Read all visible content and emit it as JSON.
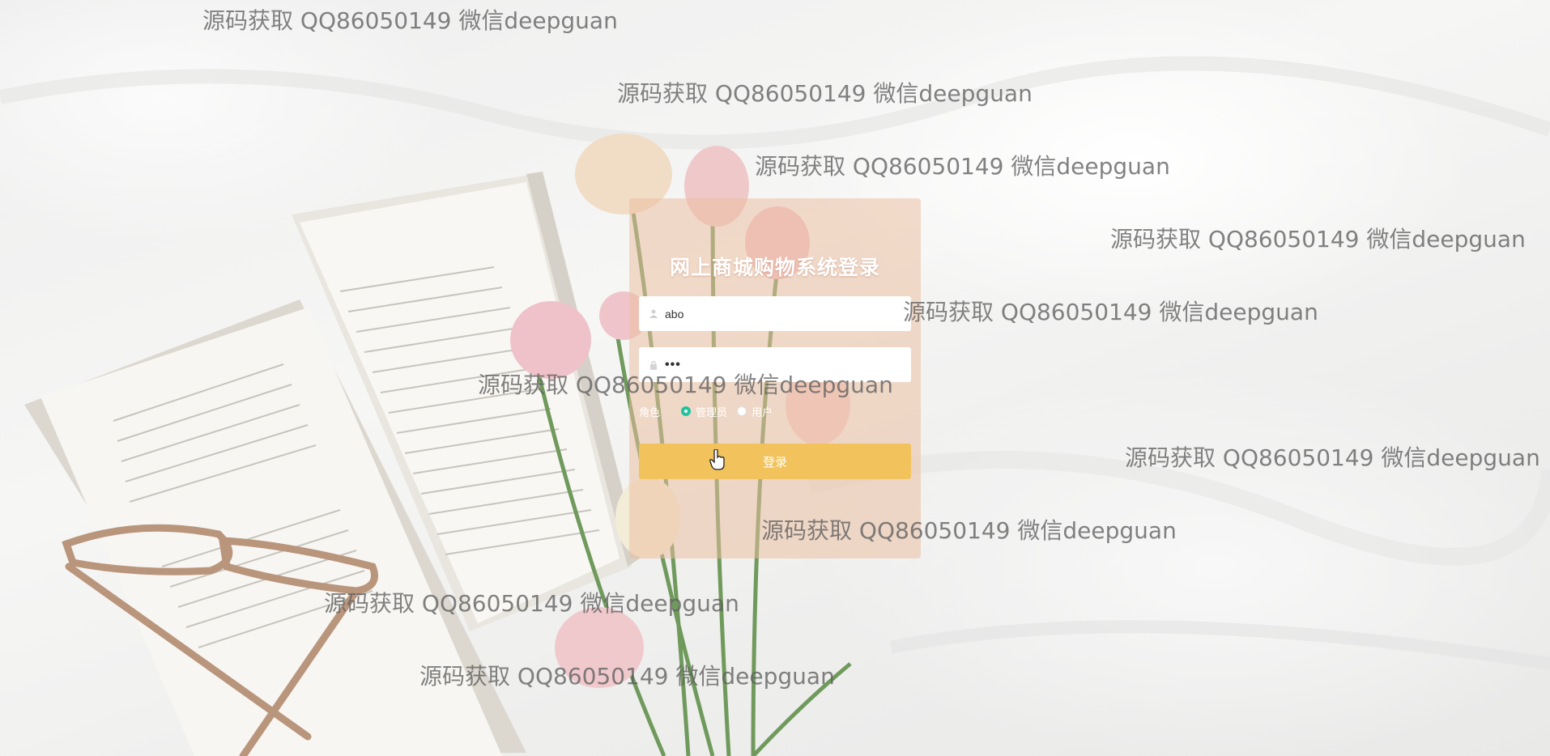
{
  "login": {
    "title": "网上商城购物系统登录",
    "username_value": "abo",
    "password_value": "•••",
    "role_label": "角色",
    "roles": [
      {
        "label": "管理员",
        "checked": true
      },
      {
        "label": "用户",
        "checked": false
      }
    ],
    "submit_label": "登录"
  },
  "watermark": {
    "text": "源码获取 QQ86050149 微信deepguan"
  },
  "colors": {
    "panel": "#ecbea0",
    "button": "#f2c35c",
    "radio_checked": "#21c39f"
  },
  "icons": {
    "username": "user-icon",
    "password": "lock-icon",
    "cursor": "hand-pointer-icon"
  }
}
